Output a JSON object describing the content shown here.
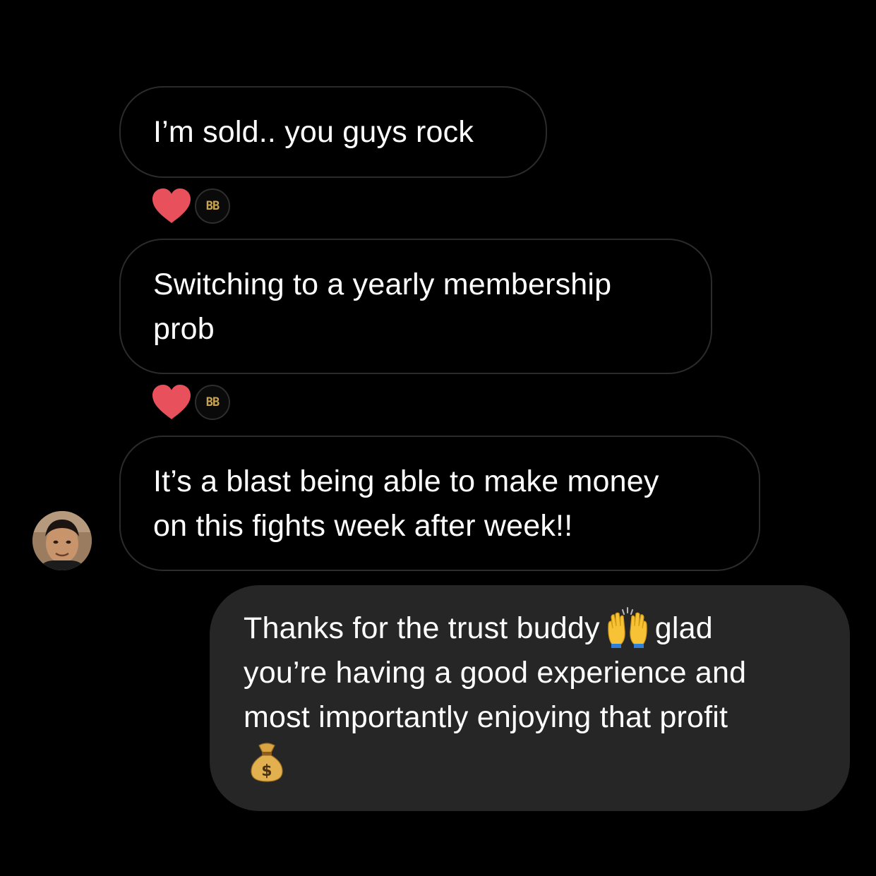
{
  "conversation": {
    "messages": [
      {
        "sender": "contact",
        "text": "I’m sold.. you guys rock"
      },
      {
        "sender": "contact",
        "line1": "Switching to a yearly membership",
        "line2": "prob"
      },
      {
        "sender": "contact",
        "line1": "It’s a blast being able to make money",
        "line2": "on this fights week after week!!"
      },
      {
        "sender": "me",
        "line1_before": "Thanks for the trust buddy",
        "line1_after": "glad",
        "line2": "you’re having a good experience and",
        "line3": "most importantly enjoying that profit",
        "emoji1": "raising-hands-icon",
        "emoji2": "money-bag-icon"
      }
    ],
    "reactions": [
      {
        "emoji": "heart-icon",
        "badge_text": "BB"
      },
      {
        "emoji": "heart-icon",
        "badge_text": "BB"
      }
    ]
  },
  "colors": {
    "background": "#000000",
    "sent_bubble": "#262626",
    "received_border": "#2b2b2b",
    "heart": "#e8505b",
    "badge_gold": "#c9a44e"
  }
}
